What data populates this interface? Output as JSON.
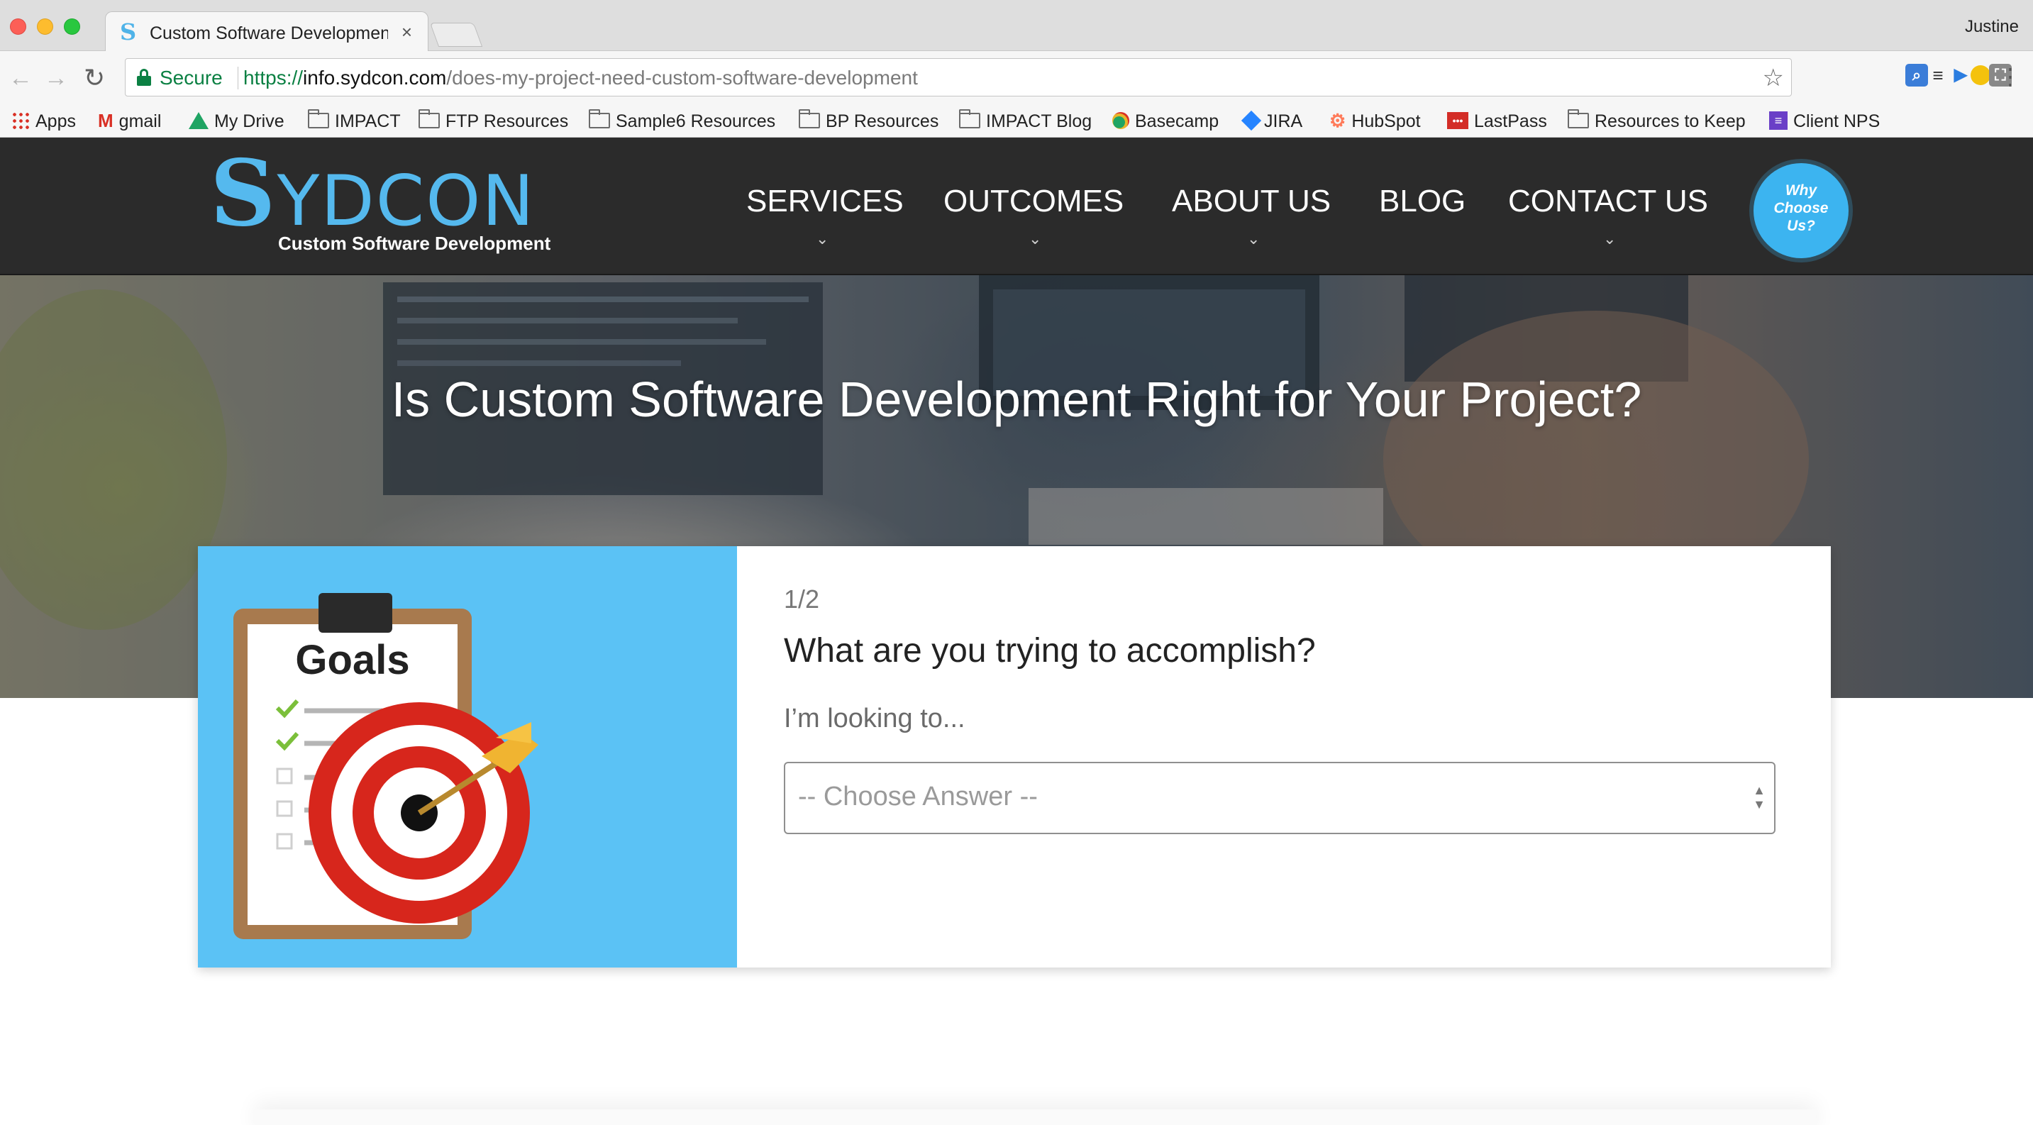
{
  "browser": {
    "tab_title": "Custom Software Development",
    "tab_close": "×",
    "profile": "Justine",
    "nav": {
      "back": "←",
      "forward": "→",
      "reload": "↻"
    },
    "security_label": "Secure",
    "url_scheme": "https://",
    "url_host": "info.sydcon.com",
    "url_path": "/does-my-project-need-custom-software-development",
    "star": "☆",
    "menu": "⋮",
    "bookmarks": [
      {
        "label": "Apps",
        "icon": "apps-grid-icon"
      },
      {
        "label": "gmail",
        "icon": "gmail-icon"
      },
      {
        "label": "My Drive",
        "icon": "drive-icon"
      },
      {
        "label": "IMPACT",
        "icon": "folder-icon"
      },
      {
        "label": "FTP Resources",
        "icon": "folder-icon"
      },
      {
        "label": "Sample6 Resources",
        "icon": "folder-icon"
      },
      {
        "label": "BP Resources",
        "icon": "folder-icon"
      },
      {
        "label": "IMPACT Blog",
        "icon": "folder-icon"
      },
      {
        "label": "Basecamp",
        "icon": "basecamp-icon"
      },
      {
        "label": "JIRA",
        "icon": "jira-icon"
      },
      {
        "label": "HubSpot",
        "icon": "hubspot-icon"
      },
      {
        "label": "LastPass",
        "icon": "lastpass-icon"
      },
      {
        "label": "Resources to Keep",
        "icon": "folder-icon"
      },
      {
        "label": "Client NPS",
        "icon": "list-icon"
      }
    ]
  },
  "site": {
    "logo_s": "S",
    "logo_word": "YDCON",
    "logo_tagline": "Custom Software Development",
    "nav": [
      {
        "label": "SERVICES",
        "caret": "⌄"
      },
      {
        "label": "OUTCOMES",
        "caret": "⌄"
      },
      {
        "label": "ABOUT US",
        "caret": "⌄"
      },
      {
        "label": "BLOG"
      },
      {
        "label": "CONTACT US",
        "caret": "⌄"
      }
    ],
    "why_button": [
      "Why",
      "Choose",
      "Us?"
    ],
    "hero_title": "Is Custom Software Development Right for Your Project?",
    "quiz": {
      "step": "1/2",
      "question": "What are you trying to accomplish?",
      "prompt": "I’m looking to...",
      "select_placeholder": "-- Choose Answer --",
      "image_heading": "Goals"
    }
  },
  "colors": {
    "accent": "#55b9ee",
    "header_bg": "#2b2b2b",
    "quiz_image_bg": "#5bc2f5",
    "target_red": "#d7261c",
    "secure_green": "#0b8043"
  }
}
